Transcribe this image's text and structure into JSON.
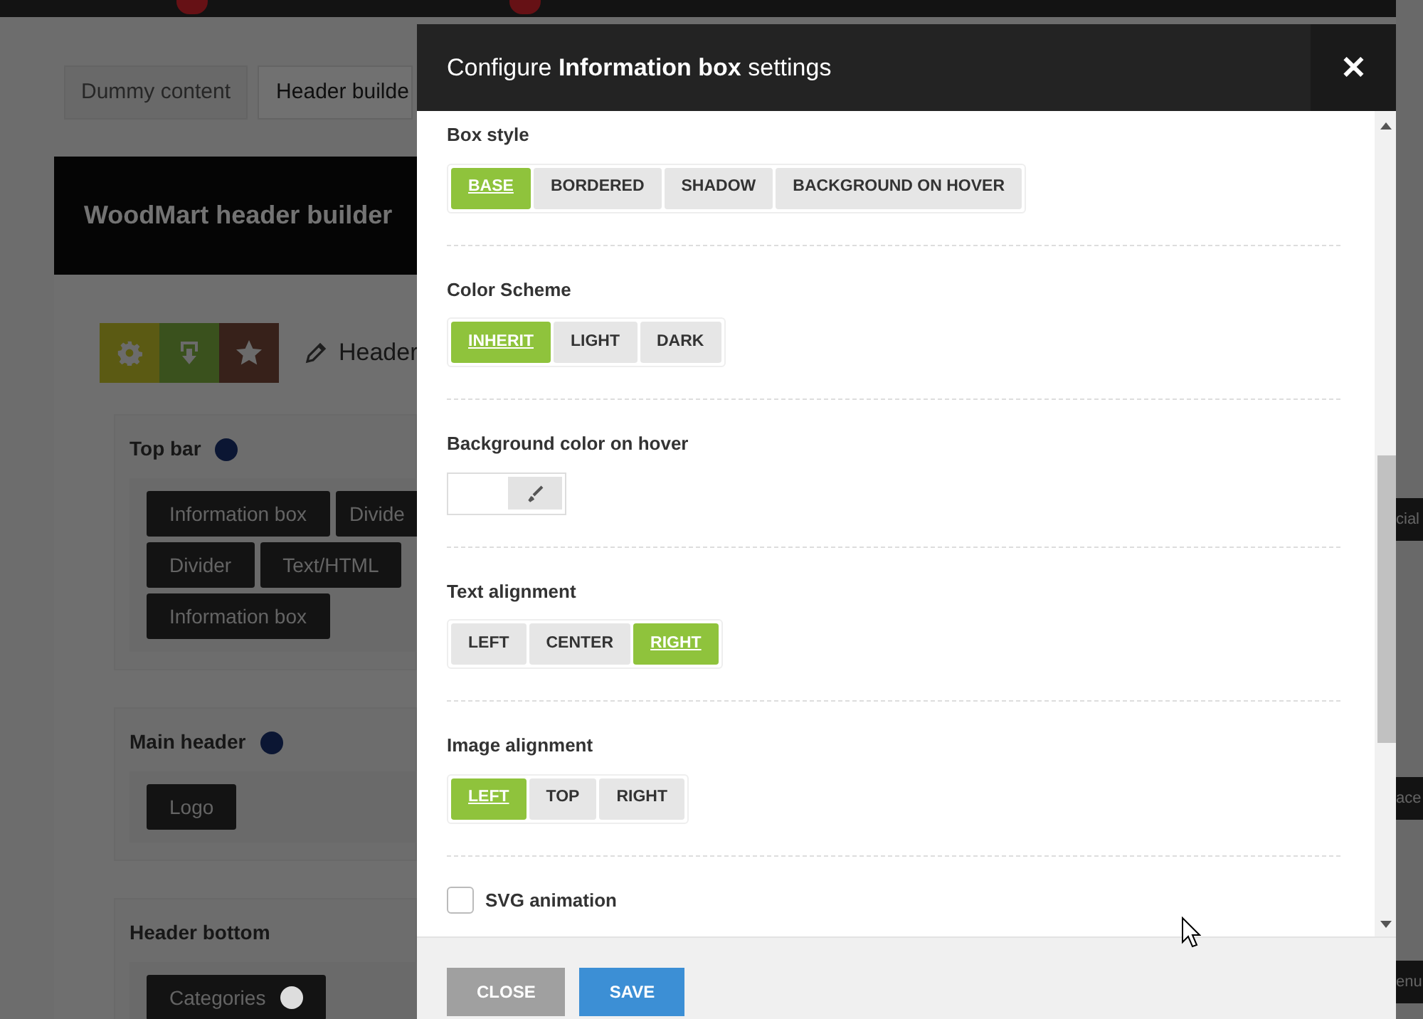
{
  "background": {
    "tabs": [
      {
        "label": "Dummy content",
        "selected": false
      },
      {
        "label": "Header builde",
        "selected": true
      }
    ],
    "builder_title": "WoodMart header builder",
    "header_name": "Header",
    "rows": [
      {
        "title": "Top bar",
        "color": "#0b1633",
        "lines": [
          [
            {
              "label": "Information box"
            },
            {
              "label": "Divide"
            }
          ],
          [
            {
              "label": "Divider"
            },
            {
              "label": "Text/HTML"
            }
          ],
          [
            {
              "label": "Information box"
            }
          ]
        ]
      },
      {
        "title": "Main header",
        "color": "#0b1633",
        "lines": [
          [
            {
              "label": "Logo"
            }
          ]
        ]
      },
      {
        "title": "Header bottom",
        "lines": [
          [
            {
              "label": "Categories",
              "color": "#dddddd"
            }
          ]
        ]
      }
    ],
    "right_edge": [
      "cial",
      "ace",
      "enu"
    ]
  },
  "modal": {
    "title": "Configure **Information box** settings",
    "close": "✕",
    "sections": [
      {
        "kind": "buttons",
        "label": "Box style",
        "options": [
          {
            "label": "BASE",
            "selected": true
          },
          {
            "label": "BORDERED",
            "selected": false
          },
          {
            "label": "SHADOW",
            "selected": false
          },
          {
            "label": "BACKGROUND ON HOVER",
            "selected": false
          }
        ]
      },
      {
        "kind": "buttons",
        "label": "Color Scheme",
        "options": [
          {
            "label": "INHERIT",
            "selected": true
          },
          {
            "label": "LIGHT",
            "selected": false
          },
          {
            "label": "DARK",
            "selected": false
          }
        ]
      },
      {
        "kind": "color",
        "label": "Background color on hover"
      },
      {
        "kind": "buttons",
        "label": "Text alignment",
        "options": [
          {
            "label": "LEFT",
            "selected": false
          },
          {
            "label": "CENTER",
            "selected": false
          },
          {
            "label": "RIGHT",
            "selected": true
          }
        ]
      },
      {
        "kind": "buttons",
        "label": "Image alignment",
        "options": [
          {
            "label": "LEFT",
            "selected": true
          },
          {
            "label": "TOP",
            "selected": false
          },
          {
            "label": "RIGHT",
            "selected": false
          }
        ]
      },
      {
        "kind": "checkbox",
        "label": "SVG animation",
        "checked": false
      }
    ],
    "buttons": [
      {
        "kind": "close",
        "label": "CLOSE"
      },
      {
        "kind": "save",
        "label": "SAVE"
      }
    ]
  }
}
